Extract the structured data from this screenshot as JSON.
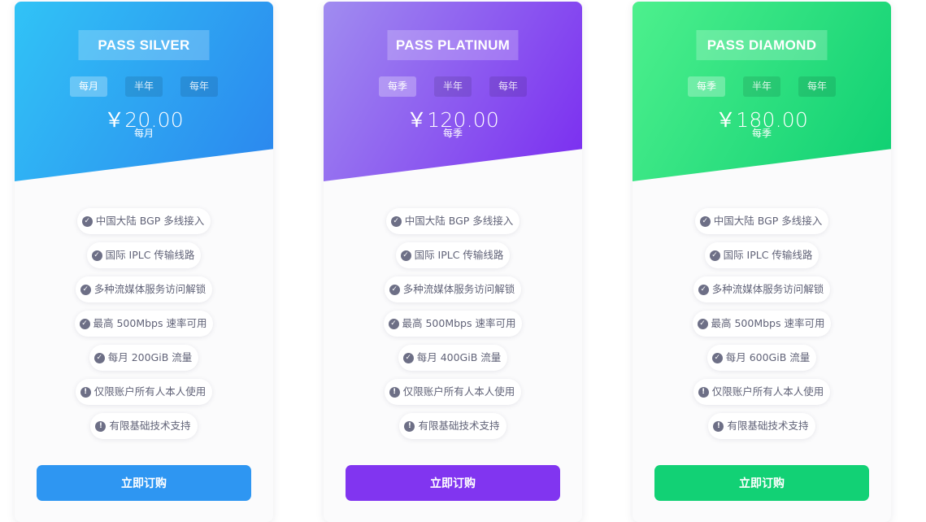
{
  "plans": [
    {
      "title": "PASS SILVER",
      "cycles": [
        "每月",
        "半年",
        "每年"
      ],
      "active_cycle": 0,
      "price": "￥20.00",
      "period": "每月",
      "features": [
        {
          "text": "中国大陆 BGP 多线接入",
          "icon": "check-circle-icon"
        },
        {
          "text": "国际 IPLC 传输线路",
          "icon": "check-circle-icon"
        },
        {
          "text": "多种流媒体服务访问解锁",
          "icon": "check-circle-icon"
        },
        {
          "text": "最高 500Mbps 速率可用",
          "icon": "check-circle-icon"
        },
        {
          "text": "每月 200GiB 流量",
          "icon": "check-circle-icon"
        },
        {
          "text": "仅限账户所有人本人使用",
          "icon": "exclamation-circle-icon"
        },
        {
          "text": "有限基础技术支持",
          "icon": "exclamation-circle-icon"
        }
      ],
      "button": "立即订购",
      "accent": "#2e96f2"
    },
    {
      "title": "PASS PLATINUM",
      "cycles": [
        "每季",
        "半年",
        "每年"
      ],
      "active_cycle": 0,
      "price": "￥120.00",
      "period": "每季",
      "features": [
        {
          "text": "中国大陆 BGP 多线接入",
          "icon": "check-circle-icon"
        },
        {
          "text": "国际 IPLC 传输线路",
          "icon": "check-circle-icon"
        },
        {
          "text": "多种流媒体服务访问解锁",
          "icon": "check-circle-icon"
        },
        {
          "text": "最高 500Mbps 速率可用",
          "icon": "check-circle-icon"
        },
        {
          "text": "每月 400GiB 流量",
          "icon": "check-circle-icon"
        },
        {
          "text": "仅限账户所有人本人使用",
          "icon": "exclamation-circle-icon"
        },
        {
          "text": "有限基础技术支持",
          "icon": "exclamation-circle-icon"
        }
      ],
      "button": "立即订购",
      "accent": "#8135f0"
    },
    {
      "title": "PASS DIAMOND",
      "cycles": [
        "每季",
        "半年",
        "每年"
      ],
      "active_cycle": 0,
      "price": "￥180.00",
      "period": "每季",
      "features": [
        {
          "text": "中国大陆 BGP 多线接入",
          "icon": "check-circle-icon"
        },
        {
          "text": "国际 IPLC 传输线路",
          "icon": "check-circle-icon"
        },
        {
          "text": "多种流媒体服务访问解锁",
          "icon": "check-circle-icon"
        },
        {
          "text": "最高 500Mbps 速率可用",
          "icon": "check-circle-icon"
        },
        {
          "text": "每月 600GiB 流量",
          "icon": "check-circle-icon"
        },
        {
          "text": "仅限账户所有人本人使用",
          "icon": "exclamation-circle-icon"
        },
        {
          "text": "有限基础技术支持",
          "icon": "exclamation-circle-icon"
        }
      ],
      "button": "立即订购",
      "accent": "#12d175"
    }
  ]
}
